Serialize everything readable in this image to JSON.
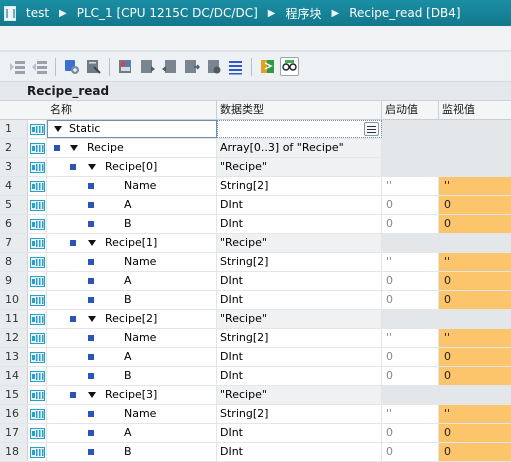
{
  "breadcrumb": {
    "items": [
      "test",
      "PLC_1 [CPU 1215C DC/DC/DC]",
      "程序块",
      "Recipe_read [DB4]"
    ],
    "separator": "▶"
  },
  "toolbar": {
    "buttons": [
      "insert-row-icon",
      "add-row-icon",
      "expand-icon",
      "keep-actual-values-icon",
      "snapshot-icon",
      "copy-snapshot-icon",
      "load-snapshot-icon",
      "copy-start-values-icon",
      "load-start-values-icon",
      "list-view-icon",
      "monitor-icon",
      "glasses-icon"
    ]
  },
  "block": {
    "title": "Recipe_read"
  },
  "table": {
    "headers": {
      "name": "名称",
      "type": "数据类型",
      "start": "启动值",
      "monitor": "监视值"
    },
    "rows": [
      {
        "num": "1",
        "name": "Static",
        "level": 0,
        "expander": true,
        "bullet": false,
        "type": "",
        "start": "",
        "mon": "",
        "kind": "static"
      },
      {
        "num": "2",
        "name": "Recipe",
        "level": 1,
        "expander": true,
        "bullet": true,
        "type": "Array[0..3] of \"Recipe\"",
        "start": "",
        "mon": "",
        "kind": "array"
      },
      {
        "num": "3",
        "name": "Recipe[0]",
        "level": 2,
        "expander": true,
        "bullet": true,
        "type": "\"Recipe\"",
        "start": "",
        "mon": "",
        "kind": "struct"
      },
      {
        "num": "4",
        "name": "Name",
        "level": 3,
        "expander": false,
        "bullet": true,
        "type": "String[2]",
        "start": "''",
        "mon": "''",
        "kind": "leaf"
      },
      {
        "num": "5",
        "name": "A",
        "level": 3,
        "expander": false,
        "bullet": true,
        "type": "DInt",
        "start": "0",
        "mon": "0",
        "kind": "leaf"
      },
      {
        "num": "6",
        "name": "B",
        "level": 3,
        "expander": false,
        "bullet": true,
        "type": "DInt",
        "start": "0",
        "mon": "0",
        "kind": "leaf"
      },
      {
        "num": "7",
        "name": "Recipe[1]",
        "level": 2,
        "expander": true,
        "bullet": true,
        "type": "\"Recipe\"",
        "start": "",
        "mon": "",
        "kind": "struct"
      },
      {
        "num": "8",
        "name": "Name",
        "level": 3,
        "expander": false,
        "bullet": true,
        "type": "String[2]",
        "start": "''",
        "mon": "''",
        "kind": "leaf"
      },
      {
        "num": "9",
        "name": "A",
        "level": 3,
        "expander": false,
        "bullet": true,
        "type": "DInt",
        "start": "0",
        "mon": "0",
        "kind": "leaf"
      },
      {
        "num": "10",
        "name": "B",
        "level": 3,
        "expander": false,
        "bullet": true,
        "type": "DInt",
        "start": "0",
        "mon": "0",
        "kind": "leaf"
      },
      {
        "num": "11",
        "name": "Recipe[2]",
        "level": 2,
        "expander": true,
        "bullet": true,
        "type": "\"Recipe\"",
        "start": "",
        "mon": "",
        "kind": "struct"
      },
      {
        "num": "12",
        "name": "Name",
        "level": 3,
        "expander": false,
        "bullet": true,
        "type": "String[2]",
        "start": "''",
        "mon": "''",
        "kind": "leaf"
      },
      {
        "num": "13",
        "name": "A",
        "level": 3,
        "expander": false,
        "bullet": true,
        "type": "DInt",
        "start": "0",
        "mon": "0",
        "kind": "leaf"
      },
      {
        "num": "14",
        "name": "B",
        "level": 3,
        "expander": false,
        "bullet": true,
        "type": "DInt",
        "start": "0",
        "mon": "0",
        "kind": "leaf"
      },
      {
        "num": "15",
        "name": "Recipe[3]",
        "level": 2,
        "expander": true,
        "bullet": true,
        "type": "\"Recipe\"",
        "start": "",
        "mon": "",
        "kind": "struct"
      },
      {
        "num": "16",
        "name": "Name",
        "level": 3,
        "expander": false,
        "bullet": true,
        "type": "String[2]",
        "start": "''",
        "mon": "''",
        "kind": "leaf"
      },
      {
        "num": "17",
        "name": "A",
        "level": 3,
        "expander": false,
        "bullet": true,
        "type": "DInt",
        "start": "0",
        "mon": "0",
        "kind": "leaf"
      },
      {
        "num": "18",
        "name": "B",
        "level": 3,
        "expander": false,
        "bullet": true,
        "type": "DInt",
        "start": "0",
        "mon": "0",
        "kind": "leaf"
      }
    ]
  },
  "colors": {
    "header_bar": "#13788c",
    "monitor_value_bg": "#fcc56b",
    "interface_icon": "#2aa0c8",
    "bullet": "#2a55b8"
  }
}
